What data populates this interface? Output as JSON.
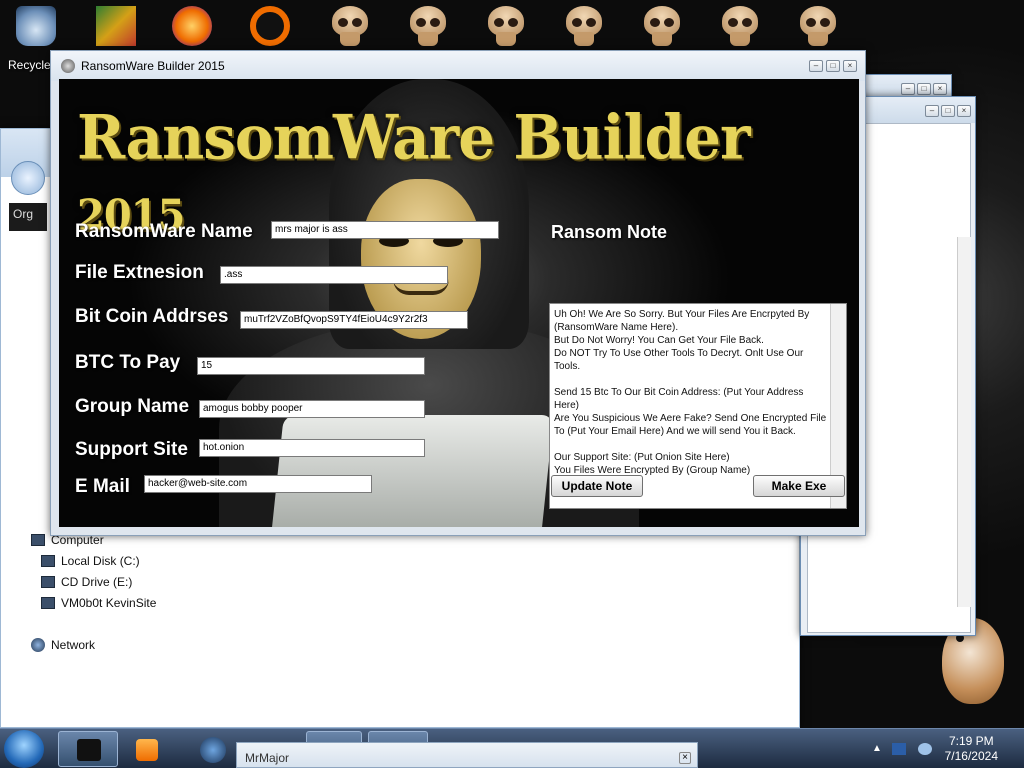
{
  "desktop": {
    "recycle_bin_label": "Recycle",
    "skull_count": 7
  },
  "main_window": {
    "title": "RansomWare Builder 2015",
    "logo_main": "RansomWare Builder",
    "logo_year": "2015",
    "fields": {
      "ransomware_name": {
        "label": "RansomWare Name",
        "value": "mrs major is ass"
      },
      "file_extension": {
        "label": "File Extnesion",
        "value": ".ass"
      },
      "bitcoin_address": {
        "label": "Bit Coin Addrses",
        "value": "muTrf2VZoBfQvopS9TY4fEioU4c9Y2r2f3"
      },
      "btc_to_pay": {
        "label": "BTC To Pay",
        "value": "15"
      },
      "group_name": {
        "label": "Group Name",
        "value": "amogus bobby pooper"
      },
      "support_site": {
        "label": "Support Site",
        "value": "hot.onion"
      },
      "email": {
        "label": "E Mail",
        "value": "hacker@web-site.com"
      }
    },
    "ransom_note": {
      "label": "Ransom Note",
      "text": "Uh Oh! We Are So Sorry. But Your Files Are Encrpyted By (RansomWare Name Here).\nBut Do Not Worry! You Can Get Your File Back.\nDo NOT Try To Use Other Tools To Decryt. Onlt Use Our Tools.\n\nSend 15 Btc To Our Bit Coin Address: (Put Your Address Here)\nAre You Suspicious We Aere Fake? Send One Encrypted File To (Put Your Email Here) And we will send You it Back.\n\nOur Support Site: (Put Onion Site Here)\nYou Files Were Encrypted By (Group Name)"
    },
    "buttons": {
      "update_note": "Update Note",
      "make_exe": "Make Exe"
    }
  },
  "explorer": {
    "toolbar_label": "Org",
    "tree": [
      {
        "label": "Computer",
        "icon": "computer-icon"
      },
      {
        "label": "Local Disk (C:)",
        "icon": "drive-icon"
      },
      {
        "label": "CD Drive (E:)",
        "icon": "cd-drive-icon"
      },
      {
        "label": "VM0b0t KevinSite",
        "icon": "network-drive-icon"
      },
      {
        "label": "Network",
        "icon": "network-icon"
      }
    ]
  },
  "taskbar": {
    "time": "7:19 PM",
    "date": "7/16/2024",
    "flyout_title": "MrMajor"
  }
}
